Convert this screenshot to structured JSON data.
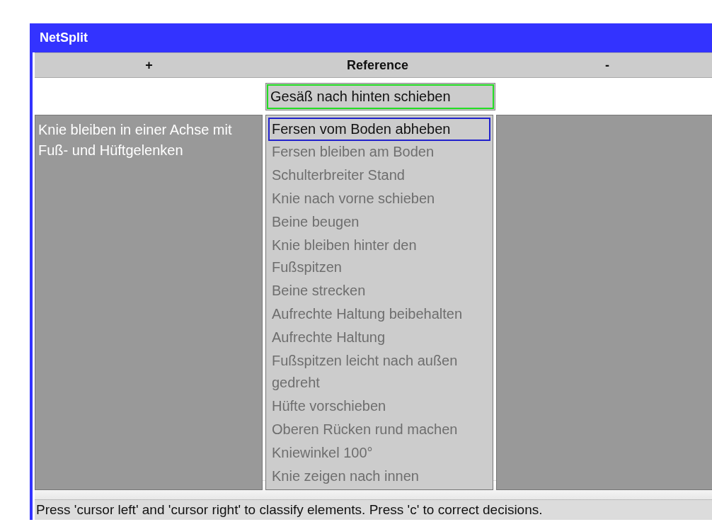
{
  "window": {
    "title": "NetSplit"
  },
  "columns": [
    "+",
    "Reference",
    "-"
  ],
  "reference": {
    "text": "Gesäß nach hinten schieben"
  },
  "plus_items": [
    {
      "text": "Knie bleiben in einer Achse mit Fuß- und Hüftgelenken"
    }
  ],
  "pool_items": [
    {
      "text": "Fersen vom Boden abheben",
      "selected": true
    },
    {
      "text": "Fersen bleiben am Boden",
      "selected": false
    },
    {
      "text": "Schulterbreiter Stand",
      "selected": false
    },
    {
      "text": "Knie nach vorne schieben",
      "selected": false
    },
    {
      "text": "Beine beugen",
      "selected": false
    },
    {
      "text": "Knie bleiben hinter den Fußspitzen",
      "selected": false
    },
    {
      "text": "Beine strecken",
      "selected": false
    },
    {
      "text": "Aufrechte Haltung beibehalten",
      "selected": false
    },
    {
      "text": "Aufrechte Haltung",
      "selected": false
    },
    {
      "text": "Fußspitzen leicht nach außen gedreht",
      "selected": false
    },
    {
      "text": "Hüfte vorschieben",
      "selected": false
    },
    {
      "text": "Oberen Rücken rund machen",
      "selected": false
    },
    {
      "text": "Kniewinkel 100°",
      "selected": false
    },
    {
      "text": "Knie zeigen nach innen",
      "selected": false
    }
  ],
  "status_bar": "Press 'cursor left' and 'cursor right' to classify elements. Press 'c' to correct decisions."
}
